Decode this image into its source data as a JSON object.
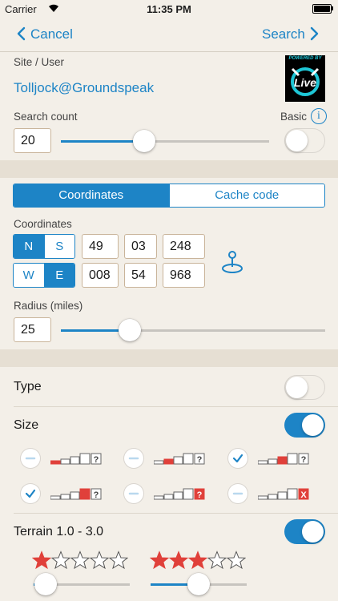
{
  "status": {
    "carrier": "Carrier",
    "time": "11:35 PM"
  },
  "nav": {
    "cancel": "Cancel",
    "search": "Search"
  },
  "site": {
    "label": "Site / User",
    "value": "Tolljock@Groundspeak",
    "logo_text": "POWERED BY",
    "logo_badge": "Live"
  },
  "search_count": {
    "label": "Search count",
    "value": "20",
    "slider_fraction": 0.4,
    "basic_label": "Basic",
    "basic_on": false,
    "info_icon": "info-icon"
  },
  "tabs": {
    "coordinates": "Coordinates",
    "cache_code": "Cache code",
    "selected": "coordinates"
  },
  "coords": {
    "label": "Coordinates",
    "ns": [
      "N",
      "S"
    ],
    "ns_selected": "N",
    "ew": [
      "W",
      "E"
    ],
    "ew_selected": "E",
    "lat": [
      "49",
      "03",
      "248"
    ],
    "lon": [
      "008",
      "54",
      "968"
    ],
    "locate_icon": "location-pin-icon"
  },
  "radius": {
    "label": "Radius (miles)",
    "value": "25",
    "slider_fraction": 0.26
  },
  "type": {
    "label": "Type",
    "on": false
  },
  "size": {
    "label": "Size",
    "on": true,
    "options": [
      {
        "state": "minus",
        "highlight": 1,
        "mark": "?"
      },
      {
        "state": "minus",
        "highlight": 2,
        "mark": "?"
      },
      {
        "state": "check",
        "highlight": 3,
        "mark": "?"
      },
      {
        "state": "check",
        "highlight": 4,
        "mark": "?"
      },
      {
        "state": "minus",
        "highlight": 0,
        "mark": "?"
      },
      {
        "state": "minus",
        "highlight": 0,
        "mark": "X"
      }
    ]
  },
  "terrain": {
    "label": "Terrain 1.0 - 3.0",
    "on": true,
    "min_stars": 1,
    "max_stars": 3,
    "total_stars": 5
  },
  "colors": {
    "accent": "#1d84c6",
    "red": "#e0403a",
    "bg": "#f3efe8"
  }
}
